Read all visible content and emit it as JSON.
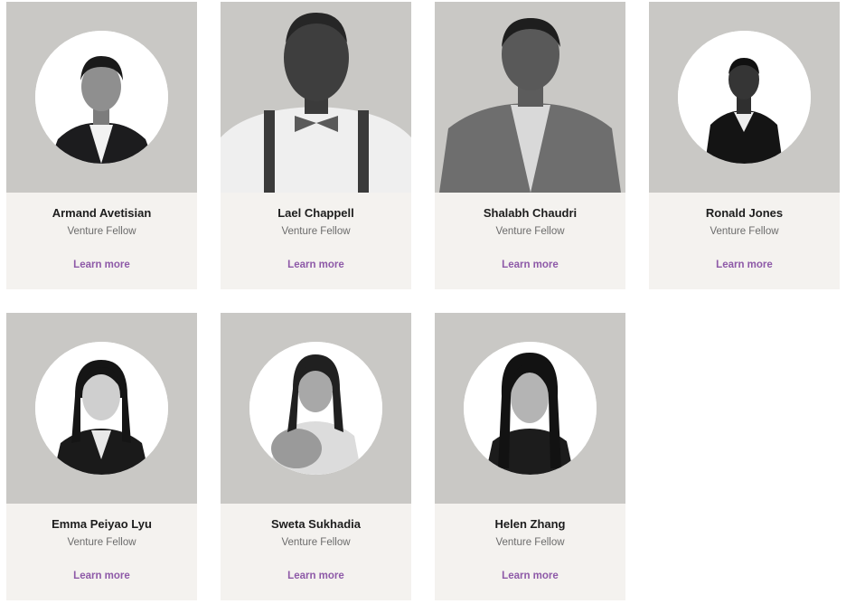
{
  "fellows": [
    {
      "name": "Armand Avetisian",
      "role": "Venture Fellow",
      "link": "Learn more"
    },
    {
      "name": "Lael Chappell",
      "role": "Venture Fellow",
      "link": "Learn more"
    },
    {
      "name": "Shalabh Chaudri",
      "role": "Venture Fellow",
      "link": "Learn more"
    },
    {
      "name": "Ronald Jones",
      "role": "Venture Fellow",
      "link": "Learn more"
    },
    {
      "name": "Emma Peiyao Lyu",
      "role": "Venture Fellow",
      "link": "Learn more"
    },
    {
      "name": "Sweta Sukhadia",
      "role": "Venture Fellow",
      "link": "Learn more"
    },
    {
      "name": "Helen Zhang",
      "role": "Venture Fellow",
      "link": "Learn more"
    }
  ],
  "colors": {
    "photo_bg": "#c9c8c5",
    "card_bg": "#f4f2ef",
    "link": "#8e5aa8"
  }
}
